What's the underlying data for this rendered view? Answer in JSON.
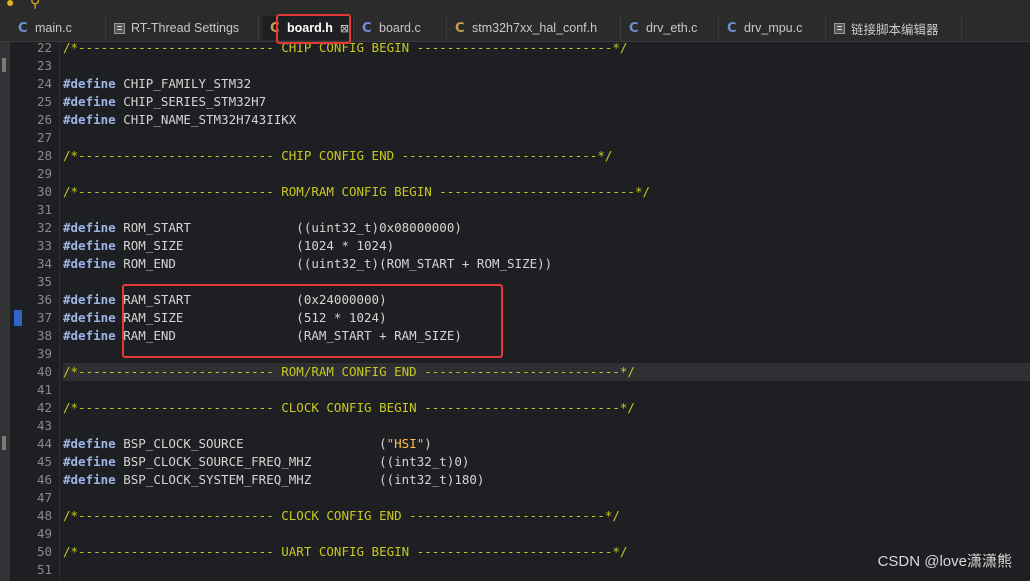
{
  "tabs": [
    {
      "label": "main.c",
      "icon": "c-file-icon"
    },
    {
      "label": "RT-Thread Settings",
      "icon": "settings-file-icon"
    },
    {
      "label": "board.h",
      "icon": "c-header-icon",
      "active": true,
      "close": "⊠"
    },
    {
      "label": "board.c",
      "icon": "c-file-icon"
    },
    {
      "label": "stm32h7xx_hal_conf.h",
      "icon": "c-header-icon"
    },
    {
      "label": "drv_eth.c",
      "icon": "c-file-icon"
    },
    {
      "label": "drv_mpu.c",
      "icon": "c-file-icon"
    },
    {
      "label": "链接脚本编辑器",
      "icon": "linker-editor-icon"
    }
  ],
  "editor": {
    "current_line": 40,
    "breakpoint_line": 37,
    "lines": [
      {
        "n": "22",
        "t": [
          [
            "cm",
            "/*-------------------------- CHIP CONFIG BEGIN --------------------------*/"
          ]
        ]
      },
      {
        "n": "23",
        "t": []
      },
      {
        "n": "24",
        "t": [
          [
            "kw",
            "#define"
          ],
          [
            "tx",
            " CHIP_FAMILY_STM32"
          ]
        ]
      },
      {
        "n": "25",
        "t": [
          [
            "kw",
            "#define"
          ],
          [
            "tx",
            " CHIP_SERIES_STM32H7"
          ]
        ]
      },
      {
        "n": "26",
        "t": [
          [
            "kw",
            "#define"
          ],
          [
            "tx",
            " CHIP_NAME_STM32H743IIKX"
          ]
        ]
      },
      {
        "n": "27",
        "t": []
      },
      {
        "n": "28",
        "t": [
          [
            "cm",
            "/*-------------------------- CHIP CONFIG END --------------------------*/"
          ]
        ]
      },
      {
        "n": "29",
        "t": []
      },
      {
        "n": "30",
        "t": [
          [
            "cm",
            "/*-------------------------- ROM/RAM CONFIG BEGIN --------------------------*/"
          ]
        ]
      },
      {
        "n": "31",
        "t": []
      },
      {
        "n": "32",
        "t": [
          [
            "kw",
            "#define"
          ],
          [
            "tx",
            " ROM_START              ((uint32_t)0x08000000)"
          ]
        ]
      },
      {
        "n": "33",
        "t": [
          [
            "kw",
            "#define"
          ],
          [
            "tx",
            " ROM_SIZE               (1024 * 1024)"
          ]
        ]
      },
      {
        "n": "34",
        "t": [
          [
            "kw",
            "#define"
          ],
          [
            "tx",
            " ROM_END                ((uint32_t)(ROM_START + ROM_SIZE))"
          ]
        ]
      },
      {
        "n": "35",
        "t": []
      },
      {
        "n": "36",
        "t": [
          [
            "kw",
            "#define"
          ],
          [
            "tx",
            " RAM_START              (0x24000000)"
          ]
        ]
      },
      {
        "n": "37",
        "t": [
          [
            "kw",
            "#define"
          ],
          [
            "tx",
            " RAM_SIZE               (512 * 1024)"
          ]
        ]
      },
      {
        "n": "38",
        "t": [
          [
            "kw",
            "#define"
          ],
          [
            "tx",
            " RAM_END                (RAM_START + RAM_SIZE)"
          ]
        ]
      },
      {
        "n": "39",
        "t": []
      },
      {
        "n": "40",
        "t": [
          [
            "cm",
            "/*-------------------------- ROM/RAM CONFIG END --------------------------*/"
          ]
        ]
      },
      {
        "n": "41",
        "t": []
      },
      {
        "n": "42",
        "t": [
          [
            "cm",
            "/*-------------------------- CLOCK CONFIG BEGIN --------------------------*/"
          ]
        ]
      },
      {
        "n": "43",
        "t": []
      },
      {
        "n": "44",
        "t": [
          [
            "kw",
            "#define"
          ],
          [
            "tx",
            " BSP_CLOCK_SOURCE                  ("
          ],
          [
            "str",
            "\"HSI\""
          ],
          [
            "tx",
            ")"
          ]
        ]
      },
      {
        "n": "45",
        "t": [
          [
            "kw",
            "#define"
          ],
          [
            "tx",
            " BSP_CLOCK_SOURCE_FREQ_MHZ         ((int32_t)0)"
          ]
        ]
      },
      {
        "n": "46",
        "t": [
          [
            "kw",
            "#define"
          ],
          [
            "tx",
            " BSP_CLOCK_SYSTEM_FREQ_MHZ         ((int32_t)180)"
          ]
        ]
      },
      {
        "n": "47",
        "t": []
      },
      {
        "n": "48",
        "t": [
          [
            "cm",
            "/*-------------------------- CLOCK CONFIG END --------------------------*/"
          ]
        ]
      },
      {
        "n": "49",
        "t": []
      },
      {
        "n": "50",
        "t": [
          [
            "cm",
            "/*-------------------------- UART CONFIG BEGIN --------------------------*/"
          ]
        ]
      },
      {
        "n": "51",
        "t": []
      }
    ]
  },
  "watermark": "CSDN @love潇潇熊",
  "colors": {
    "highlight_box": "#e53935",
    "comment": "#c8c820",
    "keyword": "#9cb4e6"
  }
}
